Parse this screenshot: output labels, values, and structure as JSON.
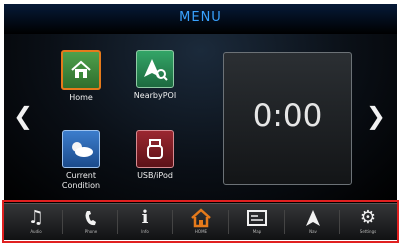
{
  "header": {
    "title": "MENU"
  },
  "apps": [
    {
      "label": "Home",
      "icon": "home-icon"
    },
    {
      "label": "NearbyPOI",
      "icon": "nearby-poi-icon"
    },
    {
      "label": "Current\nCondition",
      "icon": "weather-icon"
    },
    {
      "label": "USB/iPod",
      "icon": "usb-icon"
    }
  ],
  "clock": {
    "time": "0:00"
  },
  "dock": [
    {
      "label": "Audio",
      "icon": "music-icon"
    },
    {
      "label": "Phone",
      "icon": "phone-icon"
    },
    {
      "label": "Info",
      "icon": "info-icon"
    },
    {
      "label": "HOME",
      "icon": "home-icon",
      "active": true
    },
    {
      "label": "Map",
      "icon": "map-icon"
    },
    {
      "label": "Nav",
      "icon": "navigation-icon"
    },
    {
      "label": "Settings",
      "icon": "settings-icon"
    }
  ],
  "colors": {
    "accent": "#e57a1b",
    "title": "#39a2ff",
    "highlight": "#e02020"
  }
}
